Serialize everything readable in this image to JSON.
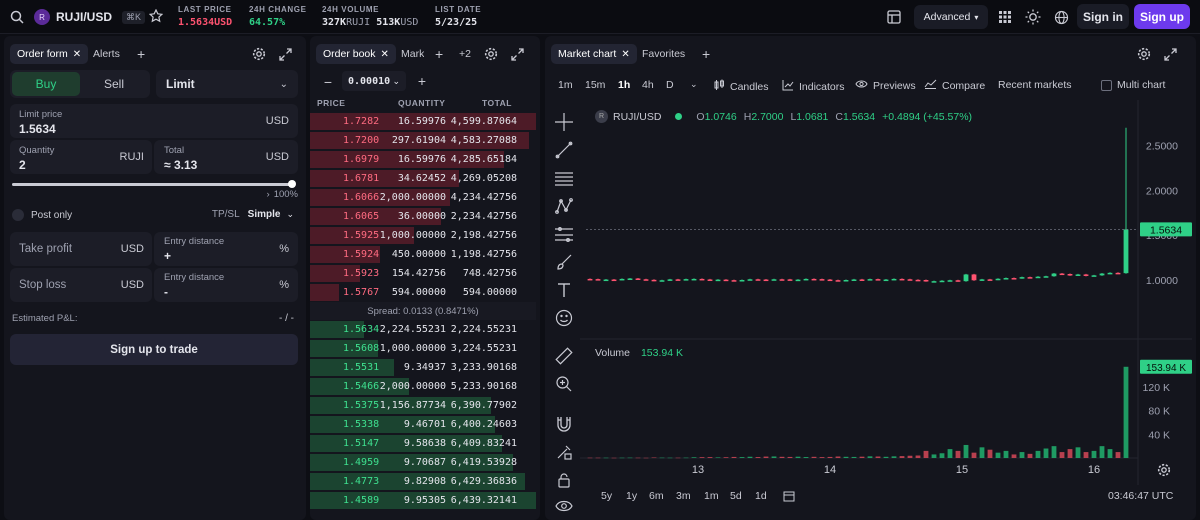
{
  "header": {
    "pair": "RUJI/USD",
    "kbd": "⌘K",
    "stats": [
      {
        "label": "LAST PRICE",
        "value": "1.5634",
        "unit": "USD",
        "color": "#ff5370"
      },
      {
        "label": "24H CHANGE",
        "value": "64.57",
        "unit": "%",
        "color": "#2fd087"
      },
      {
        "label": "24H VOLUME",
        "value": "327K",
        "unit": "RUJI",
        "value2": "513K",
        "unit2": "USD",
        "color": "#e4e5ec"
      },
      {
        "label": "LIST DATE",
        "value": "5/23/25",
        "color": "#e4e5ec"
      }
    ],
    "advanced": "Advanced",
    "sign_in": "Sign in",
    "sign_up": "Sign up"
  },
  "order_panel": {
    "tabs": [
      "Order form",
      "Alerts"
    ],
    "buy": "Buy",
    "sell": "Sell",
    "type": "Limit",
    "limit_price_label": "Limit price",
    "limit_price": "1.5634",
    "limit_price_unit": "USD",
    "quantity_label": "Quantity",
    "quantity": "2",
    "quantity_unit": "RUJI",
    "total_label": "Total",
    "total_prefix": "≈",
    "total": "3.13",
    "total_unit": "USD",
    "slider_pct": 1.0,
    "slider_label": "100%",
    "post_only": "Post only",
    "tpsl_label": "TP/SL",
    "tpsl_mode": "Simple",
    "take_profit": "Take profit",
    "take_profit_unit": "USD",
    "entry_distance": "Entry distance",
    "entry_unit": "%",
    "tp_sign": "+",
    "stop_loss": "Stop loss",
    "stop_loss_unit": "USD",
    "sl_sign": "-",
    "pnl_label": "Estimated P&L:",
    "pnl_value": "- / -",
    "cta": "Sign up to trade"
  },
  "order_book": {
    "tabs": [
      "Order book",
      "Mark"
    ],
    "extra": "+2",
    "tick": "0.00010",
    "cols": [
      "PRICE",
      "QUANTITY",
      "TOTAL"
    ],
    "spread": "Spread: 0.0133 (0.8471%)",
    "asks": [
      {
        "p": "1.7282",
        "q": "16.59976",
        "t": "4,599.87064",
        "d": 1.0
      },
      {
        "p": "1.7200",
        "q": "297.61904",
        "t": "4,583.27088",
        "d": 0.97
      },
      {
        "p": "1.6979",
        "q": "16.59976",
        "t": "4,285.65184",
        "d": 0.86
      },
      {
        "p": "1.6781",
        "q": "34.62452",
        "t": "4,269.05208",
        "d": 0.66
      },
      {
        "p": "1.6066",
        "q": "2,000.00000",
        "t": "4,234.42756",
        "d": 0.62
      },
      {
        "p": "1.6065",
        "q": "36.00000",
        "t": "2,234.42756",
        "d": 0.58
      },
      {
        "p": "1.5925",
        "q": "1,000.00000",
        "t": "2,198.42756",
        "d": 0.46
      },
      {
        "p": "1.5924",
        "q": "450.00000",
        "t": "1,198.42756",
        "d": 0.31
      },
      {
        "p": "1.5923",
        "q": "154.42756",
        "t": "748.42756",
        "d": 0.22
      },
      {
        "p": "1.5767",
        "q": "594.00000",
        "t": "594.00000",
        "d": 0.13
      }
    ],
    "bids": [
      {
        "p": "1.5634",
        "q": "2,224.55231",
        "t": "2,224.55231",
        "d": 0.24
      },
      {
        "p": "1.5608",
        "q": "1,000.00000",
        "t": "3,224.55231",
        "d": 0.3
      },
      {
        "p": "1.5531",
        "q": "9.34937",
        "t": "3,233.90168",
        "d": 0.37
      },
      {
        "p": "1.5466",
        "q": "2,000.00000",
        "t": "5,233.90168",
        "d": 0.44
      },
      {
        "p": "1.5375",
        "q": "1,156.87734",
        "t": "6,390.77902",
        "d": 0.8
      },
      {
        "p": "1.5338",
        "q": "9.46701",
        "t": "6,400.24603",
        "d": 0.82
      },
      {
        "p": "1.5147",
        "q": "9.58638",
        "t": "6,409.83241",
        "d": 0.85
      },
      {
        "p": "1.4959",
        "q": "9.70687",
        "t": "6,419.53928",
        "d": 0.9
      },
      {
        "p": "1.4773",
        "q": "9.82908",
        "t": "6,429.36836",
        "d": 0.95
      },
      {
        "p": "1.4589",
        "q": "9.95305",
        "t": "6,439.32141",
        "d": 1.0
      }
    ]
  },
  "chart_panel": {
    "tabs": [
      "Market chart",
      "Favorites"
    ],
    "timeframes": [
      "1m",
      "15m",
      "1h",
      "4h",
      "D"
    ],
    "active_tf": "1h",
    "tools": [
      "Candles",
      "Indicators",
      "Previews",
      "Compare",
      "Recent markets"
    ],
    "multi_chart": "Multi chart",
    "legend": {
      "symbol": "RUJI/USD",
      "o": "1.0746",
      "h": "2.7000",
      "l": "1.0681",
      "c": "1.5634",
      "chg": "+0.4894 (+45.57%)"
    },
    "volume_label": "Volume",
    "volume_value": "153.94 K",
    "ranges": [
      "5y",
      "1y",
      "6m",
      "3m",
      "1m",
      "5d",
      "1d"
    ],
    "time": "03:46:47 UTC"
  },
  "chart_data": {
    "type": "candlestick",
    "price_ticks": [
      "2.5000",
      "2.0000",
      "1.5000",
      "1.0000"
    ],
    "price_tick_values": [
      2.5,
      2.0,
      1.5,
      1.0
    ],
    "last_price": "1.5634",
    "ylim": [
      0.35,
      2.92
    ],
    "volume_ticks": [
      "120 K",
      "80 K",
      "40 K"
    ],
    "volume_tick_values": [
      120,
      80,
      40
    ],
    "vol_ylim": [
      0,
      162
    ],
    "x_ticks": [
      "13",
      "14",
      "15",
      "16"
    ],
    "x_tick_index": [
      13.5,
      30,
      46.5,
      63
    ],
    "candles": [
      {
        "o": 1.01,
        "c": 1.008,
        "v": 0.5
      },
      {
        "o": 1.008,
        "c": 1.0,
        "v": 0.5
      },
      {
        "o": 1.0,
        "c": 1.003,
        "v": 0.5
      },
      {
        "o": 1.003,
        "c": 1.001,
        "v": 0.4
      },
      {
        "o": 1.001,
        "c": 1.01,
        "v": 0.5
      },
      {
        "o": 1.01,
        "c": 1.015,
        "v": 0.6
      },
      {
        "o": 1.015,
        "c": 1.006,
        "v": 0.5
      },
      {
        "o": 1.006,
        "c": 1.0,
        "v": 0.4
      },
      {
        "o": 1.0,
        "c": 0.99,
        "v": 0.8
      },
      {
        "o": 0.99,
        "c": 0.995,
        "v": 0.6
      },
      {
        "o": 0.995,
        "c": 1.005,
        "v": 0.5
      },
      {
        "o": 1.005,
        "c": 1.002,
        "v": 0.5
      },
      {
        "o": 1.002,
        "c": 1.008,
        "v": 0.6
      },
      {
        "o": 1.008,
        "c": 1.01,
        "v": 1.2
      },
      {
        "o": 1.01,
        "c": 1.004,
        "v": 1.4
      },
      {
        "o": 1.004,
        "c": 0.999,
        "v": 1.5
      },
      {
        "o": 0.999,
        "c": 1.002,
        "v": 1.0
      },
      {
        "o": 1.002,
        "c": 0.996,
        "v": 1.3
      },
      {
        "o": 0.996,
        "c": 0.992,
        "v": 1.8
      },
      {
        "o": 0.992,
        "c": 0.998,
        "v": 1.5
      },
      {
        "o": 0.998,
        "c": 1.006,
        "v": 2.1
      },
      {
        "o": 1.006,
        "c": 1.003,
        "v": 1.6
      },
      {
        "o": 1.003,
        "c": 1.0,
        "v": 2.4
      },
      {
        "o": 1.0,
        "c": 1.006,
        "v": 2.6
      },
      {
        "o": 1.006,
        "c": 1.005,
        "v": 2.0
      },
      {
        "o": 1.005,
        "c": 0.998,
        "v": 1.8
      },
      {
        "o": 0.998,
        "c": 1.002,
        "v": 2.2
      },
      {
        "o": 1.002,
        "c": 1.01,
        "v": 1.6
      },
      {
        "o": 1.01,
        "c": 1.008,
        "v": 2.0
      },
      {
        "o": 1.008,
        "c": 1.003,
        "v": 1.5
      },
      {
        "o": 1.003,
        "c": 0.996,
        "v": 1.8
      },
      {
        "o": 0.996,
        "c": 0.99,
        "v": 2.5
      },
      {
        "o": 0.99,
        "c": 0.998,
        "v": 2.0
      },
      {
        "o": 0.998,
        "c": 1.004,
        "v": 1.8
      },
      {
        "o": 1.004,
        "c": 1.0,
        "v": 2.2
      },
      {
        "o": 1.0,
        "c": 1.008,
        "v": 2.8
      },
      {
        "o": 1.008,
        "c": 1.0,
        "v": 2.5
      },
      {
        "o": 1.0,
        "c": 1.003,
        "v": 2.0
      },
      {
        "o": 1.003,
        "c": 1.01,
        "v": 2.8
      },
      {
        "o": 1.01,
        "c": 1.006,
        "v": 3.2
      },
      {
        "o": 1.006,
        "c": 1.0,
        "v": 3.8
      },
      {
        "o": 1.0,
        "c": 0.998,
        "v": 4.2
      },
      {
        "o": 0.998,
        "c": 0.985,
        "v": 12
      },
      {
        "o": 0.985,
        "c": 0.985,
        "v": 6
      },
      {
        "o": 0.985,
        "c": 0.99,
        "v": 8
      },
      {
        "o": 0.99,
        "c": 0.995,
        "v": 15
      },
      {
        "o": 0.995,
        "c": 0.985,
        "v": 12
      },
      {
        "o": 0.985,
        "c": 1.06,
        "v": 22
      },
      {
        "o": 1.06,
        "c": 0.995,
        "v": 9
      },
      {
        "o": 0.995,
        "c": 1.005,
        "v": 18
      },
      {
        "o": 1.005,
        "c": 1.003,
        "v": 14
      },
      {
        "o": 1.003,
        "c": 1.012,
        "v": 9
      },
      {
        "o": 1.012,
        "c": 1.02,
        "v": 12
      },
      {
        "o": 1.02,
        "c": 1.018,
        "v": 6
      },
      {
        "o": 1.018,
        "c": 1.03,
        "v": 10
      },
      {
        "o": 1.03,
        "c": 1.028,
        "v": 7
      },
      {
        "o": 1.028,
        "c": 1.035,
        "v": 12
      },
      {
        "o": 1.035,
        "c": 1.04,
        "v": 16
      },
      {
        "o": 1.04,
        "c": 1.07,
        "v": 20
      },
      {
        "o": 1.07,
        "c": 1.065,
        "v": 10
      },
      {
        "o": 1.065,
        "c": 1.05,
        "v": 15
      },
      {
        "o": 1.05,
        "c": 1.06,
        "v": 18
      },
      {
        "o": 1.06,
        "c": 1.045,
        "v": 10
      },
      {
        "o": 1.045,
        "c": 1.05,
        "v": 12
      },
      {
        "o": 1.05,
        "c": 1.07,
        "v": 20
      },
      {
        "o": 1.07,
        "c": 1.078,
        "v": 15
      },
      {
        "o": 1.078,
        "c": 1.074,
        "v": 10
      },
      {
        "o": 1.0746,
        "c": 1.5634,
        "h": 2.7,
        "l": 1.0681,
        "v": 153.94
      }
    ]
  }
}
